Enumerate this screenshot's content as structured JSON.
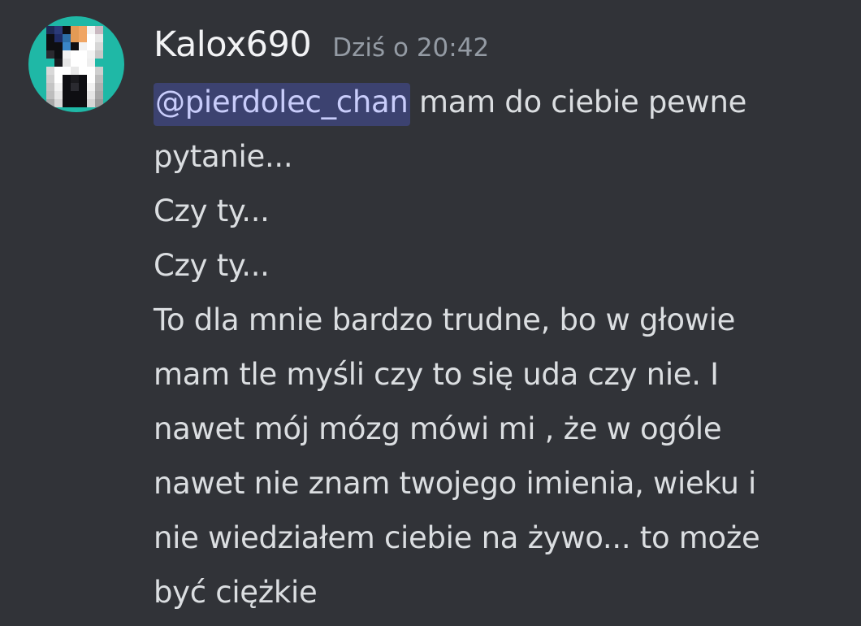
{
  "message": {
    "username": "Kalox690",
    "timestamp": "Dziś o 20:42",
    "mention": "@pierdolec_chan",
    "lines": [
      " mam do ciebie pewne",
      "pytanie...",
      "Czy ty...",
      "Czy ty...",
      "To dla mnie bardzo trudne, bo w głowie",
      "mam tle myśli czy to się uda czy nie. I",
      "nawet mój mózg mówi mi , że w ogóle",
      "nawet nie znam twojego imienia, wieku i",
      "nie wiedziałem ciebie na żywo... to może",
      "być ciężkie"
    ]
  },
  "colors": {
    "background": "#313338",
    "avatar_background": "#1fb8a6",
    "username": "#f2f3f5",
    "timestamp": "#949ba4",
    "text": "#dbdee1",
    "mention_background": "#3c4270",
    "mention_text": "#c9cdfb"
  }
}
